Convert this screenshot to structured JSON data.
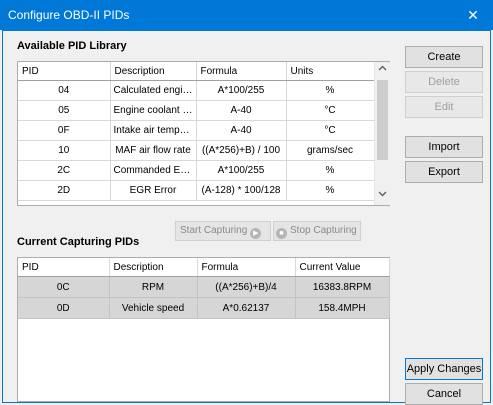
{
  "window": {
    "title": "Configure OBD-II PIDs",
    "close_glyph": "✕"
  },
  "library": {
    "title": "Available PID Library",
    "columns": [
      "PID",
      "Description",
      "Formula",
      "Units"
    ],
    "rows": [
      {
        "pid": "04",
        "description": "Calculated engin...",
        "formula": "A*100/255",
        "units": "%"
      },
      {
        "pid": "05",
        "description": "Engine coolant t...",
        "formula": "A-40",
        "units": "°C"
      },
      {
        "pid": "0F",
        "description": "Intake air temper...",
        "formula": "A-40",
        "units": "°C"
      },
      {
        "pid": "10",
        "description": "MAF air flow rate",
        "formula": "((A*256)+B) / 100",
        "units": "grams/sec"
      },
      {
        "pid": "2C",
        "description": "Commanded EGR",
        "formula": "A*100/255",
        "units": "%"
      },
      {
        "pid": "2D",
        "description": "EGR Error",
        "formula": "(A-128) * 100/128",
        "units": "%"
      }
    ],
    "scroll_up_icon": "chevron-up-icon",
    "scroll_down_icon": "chevron-down-icon"
  },
  "capture": {
    "start_label": "Start Capturing",
    "stop_label": "Stop Capturing",
    "start_icon_glyph": "▶",
    "stop_icon_glyph": "■",
    "title": "Current Capturing PIDs",
    "columns": [
      "PID",
      "Description",
      "Formula",
      "Current Value"
    ],
    "rows": [
      {
        "pid": "0C",
        "description": "RPM",
        "formula": "((A*256)+B)/4",
        "value": "16383.8RPM"
      },
      {
        "pid": "0D",
        "description": "Vehicle speed",
        "formula": "A*0.62137",
        "value": "158.4MPH"
      }
    ]
  },
  "buttons": {
    "create": "Create",
    "delete": "Delete",
    "edit": "Edit",
    "import": "Import",
    "export": "Export",
    "apply": "Apply Changes",
    "cancel": "Cancel"
  },
  "colors": {
    "titlebar": "#0078d7",
    "selected_row": "#d6d6d6"
  }
}
